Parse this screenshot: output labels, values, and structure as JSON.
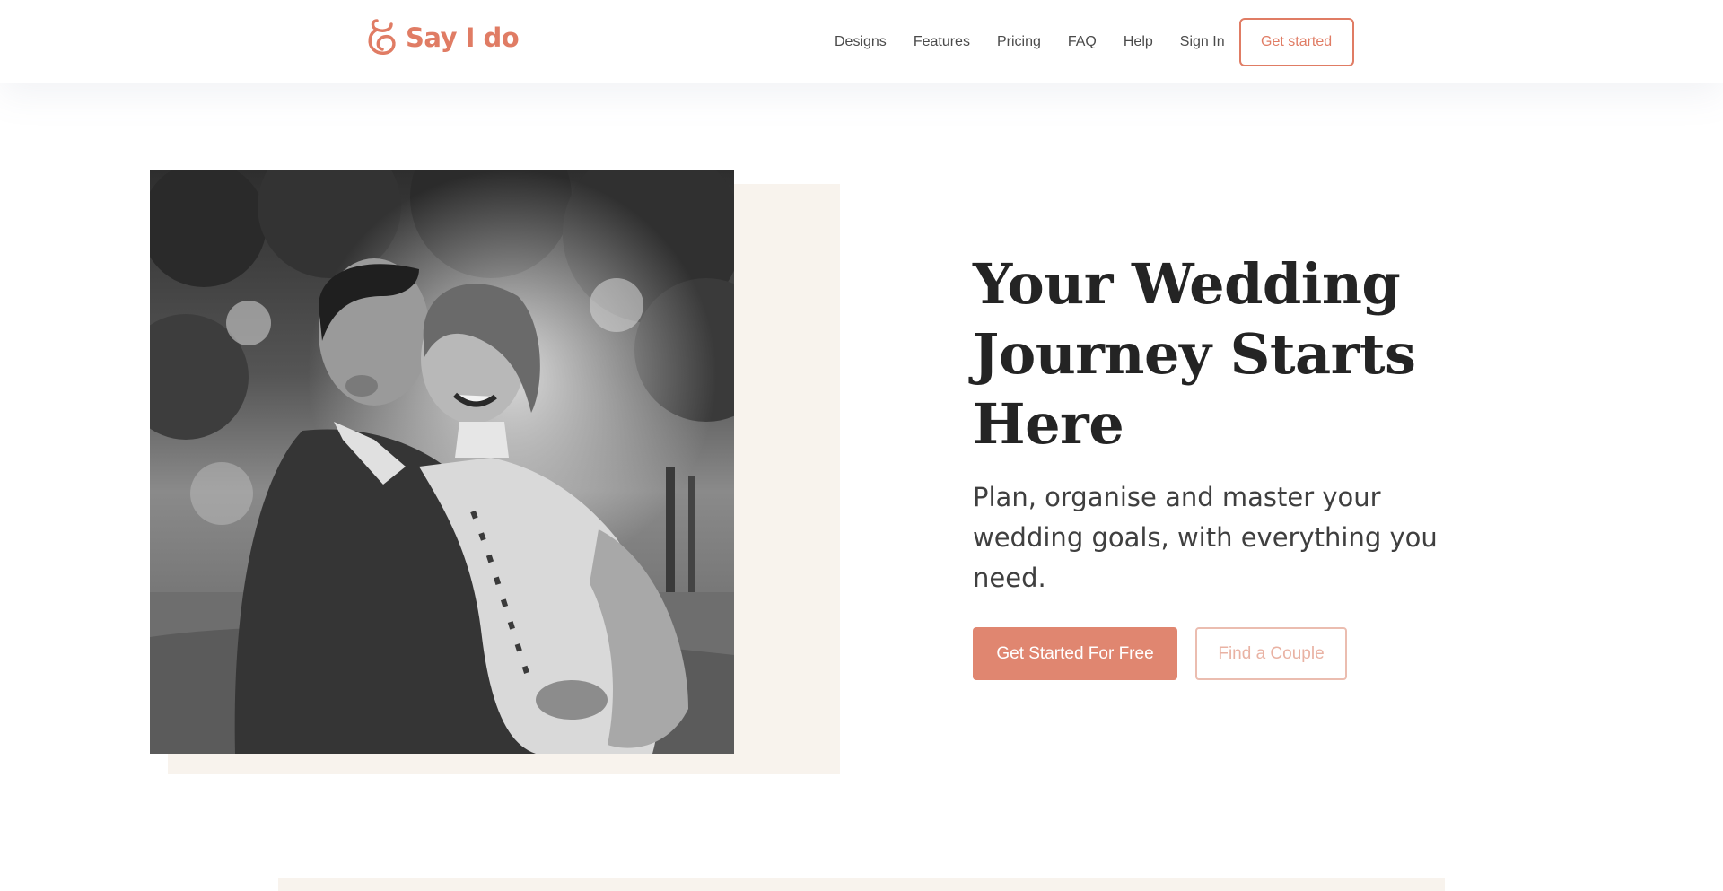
{
  "brand": {
    "name": "Say I do",
    "color": "#e07c64",
    "logo_icon": "ribbon-knot-icon"
  },
  "nav": {
    "links": [
      {
        "label": "Designs"
      },
      {
        "label": "Features"
      },
      {
        "label": "Pricing"
      },
      {
        "label": "FAQ"
      },
      {
        "label": "Help"
      },
      {
        "label": "Sign In"
      }
    ],
    "cta_label": "Get started"
  },
  "hero": {
    "title": "Your Wedding Journey Starts Here",
    "subtitle": "Plan, organise and master your wedding goals, with everything you need.",
    "primary_cta": "Get Started For Free",
    "secondary_cta": "Find a Couple",
    "backdrop_color": "#f8f3ed"
  }
}
